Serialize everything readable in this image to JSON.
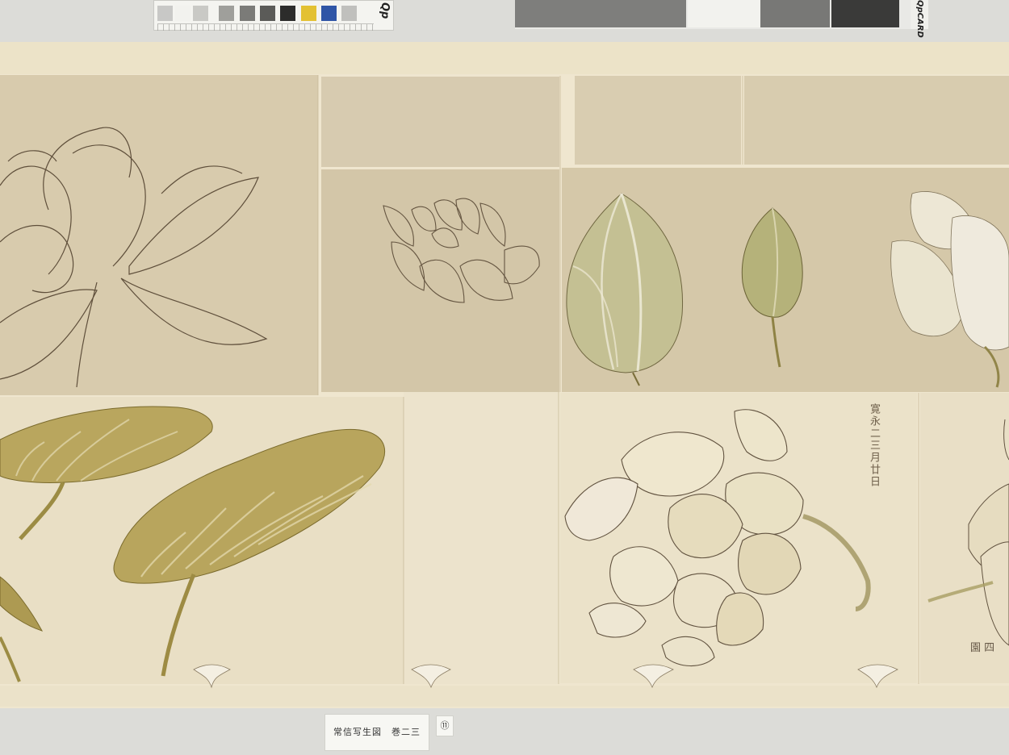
{
  "color_card": {
    "brand": "Qp",
    "swatch_colors": [
      "#c8c8c6",
      "#f2f2ee",
      "#c9c9c5",
      "#9f9f9b",
      "#7b7b78",
      "#5b5b58",
      "#2c2c2b",
      "#e3c132",
      "#2f55a6",
      "#c0c0bd"
    ]
  },
  "gray_card": {
    "brand": "QpCARD"
  },
  "scroll": {
    "inscription": "寛永二三月廿日",
    "seal": "園 四"
  },
  "caption": {
    "title": "常信写生図　巻二三",
    "plate_number": "⑪"
  },
  "colors": {
    "backdrop": "#dcdcd8",
    "paper": "#eae2cc",
    "paper_darker": "#d6c9ac",
    "ink": "#4a3a28",
    "leaf": "#b6a35a",
    "leaf_dark": "#8b7a34",
    "bud": "#c2bf8e"
  }
}
